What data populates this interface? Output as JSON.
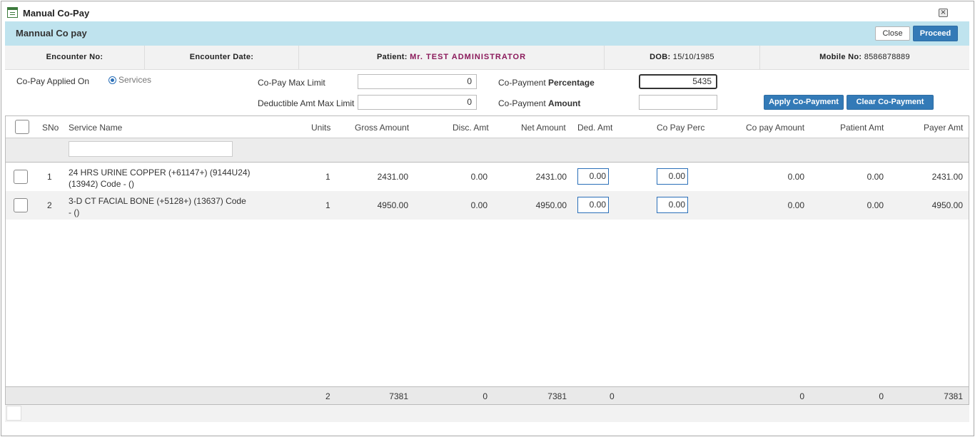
{
  "window": {
    "title": "Manual Co-Pay"
  },
  "header": {
    "title": "Mannual Co pay",
    "close_label": "Close",
    "proceed_label": "Proceed"
  },
  "info": {
    "encounter_no_label": "Encounter No:",
    "encounter_date_label": "Encounter Date:",
    "patient_label": "Patient:",
    "patient_name": "Mr. TEST ADMINISTRATOR",
    "dob_label": "DOB:",
    "dob_value": "15/10/1985",
    "mobile_label": "Mobile No:",
    "mobile_value": "8586878889"
  },
  "form": {
    "applied_on_label": "Co-Pay Applied On",
    "services_option": "Services",
    "max_limit_label": "Co-Pay Max Limit",
    "max_limit_value": "0",
    "deductible_label": "Deductible Amt Max Limit",
    "deductible_value": "0",
    "percentage_label_prefix": "Co-Payment",
    "percentage_label_bold": "Percentage",
    "percentage_value": "5435",
    "amount_label_prefix": "Co-Payment",
    "amount_label_bold": "Amount",
    "amount_value": "",
    "apply_label": "Apply Co-Payment",
    "clear_label": "Clear Co-Payment"
  },
  "grid": {
    "columns": {
      "sno": "SNo",
      "service": "Service Name",
      "units": "Units",
      "gross": "Gross Amount",
      "disc": "Disc. Amt",
      "net": "Net Amount",
      "ded": "Ded. Amt",
      "copay_perc": "Co Pay Perc",
      "copay_amount": "Co pay Amount",
      "patient_amt": "Patient Amt",
      "payer_amt": "Payer Amt"
    },
    "rows": [
      {
        "sno": "1",
        "service": "24 HRS URINE COPPER (+61147+) (9144U24) (13942) Code - ()",
        "units": "1",
        "gross": "2431.00",
        "disc": "0.00",
        "net": "2431.00",
        "ded": "0.00",
        "copay_perc": "0.00",
        "copay_amount": "0.00",
        "patient_amt": "0.00",
        "payer_amt": "2431.00"
      },
      {
        "sno": "2",
        "service": "3-D CT FACIAL BONE (+5128+) (13637) Code - ()",
        "units": "1",
        "gross": "4950.00",
        "disc": "0.00",
        "net": "4950.00",
        "ded": "0.00",
        "copay_perc": "0.00",
        "copay_amount": "0.00",
        "patient_amt": "0.00",
        "payer_amt": "4950.00"
      }
    ],
    "totals": {
      "units": "2",
      "gross": "7381",
      "disc": "0",
      "net": "7381",
      "ded": "0",
      "copay_amount": "0",
      "patient_amt": "0",
      "payer_amt": "7381"
    }
  }
}
